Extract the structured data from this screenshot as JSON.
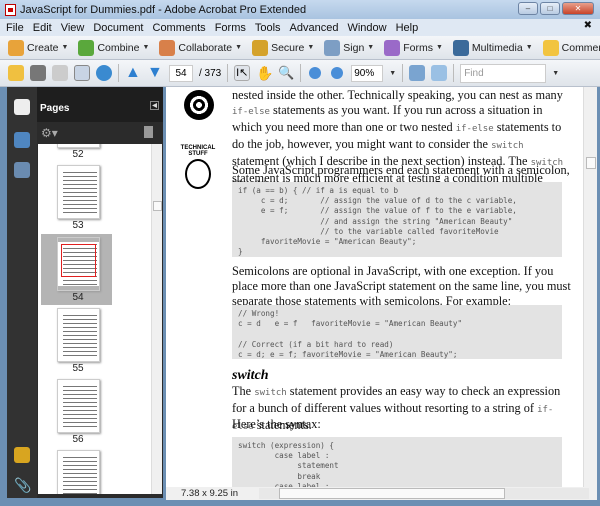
{
  "window": {
    "title": "JavaScript for Dummies.pdf - Adobe Acrobat Pro Extended"
  },
  "menu": [
    "File",
    "Edit",
    "View",
    "Document",
    "Comments",
    "Forms",
    "Tools",
    "Advanced",
    "Window",
    "Help"
  ],
  "toolbar1": [
    {
      "label": "Create",
      "icon": "create-icon",
      "color": "#e8a33a"
    },
    {
      "label": "Combine",
      "icon": "combine-icon",
      "color": "#5aa83c"
    },
    {
      "label": "Collaborate",
      "icon": "collaborate-icon",
      "color": "#d8804a"
    },
    {
      "label": "Secure",
      "icon": "lock-icon",
      "color": "#d4a22b"
    },
    {
      "label": "Sign",
      "icon": "pen-icon",
      "color": "#7d9ec4"
    },
    {
      "label": "Forms",
      "icon": "forms-icon",
      "color": "#9a6ac8"
    },
    {
      "label": "Multimedia",
      "icon": "multimedia-icon",
      "color": "#3b6a9a"
    },
    {
      "label": "Comment",
      "icon": "comment-icon",
      "color": "#f2c440"
    }
  ],
  "nav": {
    "page": "54",
    "total": "/ 373",
    "zoom": "90%",
    "find_placeholder": "Find"
  },
  "panel": {
    "title": "Pages",
    "thumbs": [
      "52",
      "53",
      "54",
      "55",
      "56"
    ],
    "current": "54"
  },
  "doc": {
    "p1": [
      "nested inside the other. Technically speaking, you can nest as many ",
      "if-else",
      "statements as you want. If you run across a situation in which you need more than one or two nested ",
      "if-else",
      " statements to do the job, however, you might want to consider the ",
      "switch",
      " statement (which I describe in the next section) instead. The ",
      "switch",
      " statement is much more efficient at testing a condition multiple times."
    ],
    "icon_label": "TECHNICAL STUFF",
    "p2": "Some JavaScript programmers end each statement with a semicolon, like this:",
    "code1": "if (a == b) { // if a is equal to b\n     c = d;       // assign the value of d to the c variable,\n     e = f;       // assign the value of f to the e variable,\n                  // and assign the string \"American Beauty\"\n                  // to the variable called favoriteMovie\n     favoriteMovie = \"American Beauty\";\n}",
    "p3": "Semicolons are optional in JavaScript, with one exception. If you place more than one JavaScript statement on the same line, you must separate those statements with semicolons. For example:",
    "code2": "// Wrong!\nc = d   e = f   favoriteMovie = \"American Beauty\"\n\n// Correct (if a bit hard to read)\nc = d; e = f; favoriteMovie = \"American Beauty\";",
    "heading": "switch",
    "p4": [
      "The ",
      "switch",
      " statement provides an easy way to check an expression for a bunch of different values without resorting to a string of ",
      "if-else",
      " statements."
    ],
    "p5": "Here’s the syntax:",
    "code3": "switch (expression) {\n        case label :\n             statement\n             break\n        case label :"
  },
  "status": {
    "size": "7.38 x 9.25 in"
  }
}
